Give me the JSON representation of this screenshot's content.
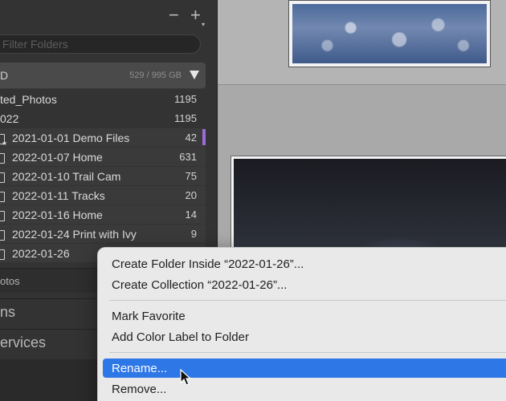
{
  "panel": {
    "minus_label": "−",
    "plus_label": "+",
    "filter_placeholder": "Filter Folders",
    "volume": {
      "name": "D",
      "usage": "529 / 995 GB"
    },
    "folders": [
      {
        "name": "ted_Photos",
        "count": "1195"
      },
      {
        "name": "022",
        "count": "1195"
      }
    ],
    "subfolders": [
      {
        "name": "2021-01-01 Demo Files",
        "count": "42"
      },
      {
        "name": "2022-01-07 Home",
        "count": "631"
      },
      {
        "name": "2022-01-10 Trail Cam",
        "count": "75"
      },
      {
        "name": "2022-01-11 Tracks",
        "count": "20"
      },
      {
        "name": "2022-01-16 Home",
        "count": "14"
      },
      {
        "name": "2022-01-24 Print with Ivy",
        "count": "9"
      },
      {
        "name": "2022-01-26",
        "count": ""
      }
    ],
    "sections": {
      "photos": "otos",
      "collections": "ns",
      "services": "ervices"
    },
    "colors": {
      "label_purple": "#9b6bd9"
    }
  },
  "context_menu": {
    "items": [
      {
        "label": "Create Folder Inside “2022-01-26”..."
      },
      {
        "label": "Create Collection “2022-01-26”..."
      },
      {
        "label": "Mark Favorite"
      },
      {
        "label": "Add Color Label to Folder"
      },
      {
        "label": "Rename..."
      },
      {
        "label": "Remove..."
      }
    ],
    "highlight_color": "#2e77e6"
  }
}
